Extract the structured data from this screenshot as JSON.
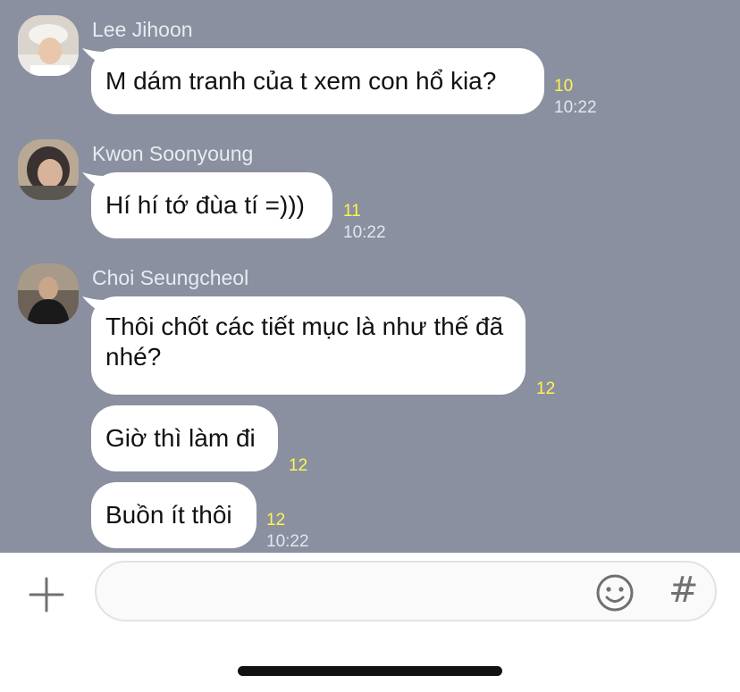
{
  "messages": [
    {
      "sender": "Lee Jihoon",
      "bubbles": [
        {
          "text": "M dám tranh của t xem con hổ kia?",
          "read_count": "10",
          "time": "10:22"
        }
      ]
    },
    {
      "sender": "Kwon Soonyoung",
      "bubbles": [
        {
          "text": "Hí hí tớ đùa tí =)))",
          "read_count": "11",
          "time": "10:22"
        }
      ]
    },
    {
      "sender": "Choi Seungcheol",
      "bubbles": [
        {
          "text": "Thôi chốt các tiết mục là như thế đã nhé?",
          "read_count": "12"
        },
        {
          "text": "Giờ thì làm đi",
          "read_count": "12"
        },
        {
          "text": "Buồn ít thôi",
          "read_count": "12",
          "time": "10:22"
        }
      ]
    }
  ],
  "composer": {
    "plus_icon": "plus-icon",
    "input_value": "",
    "emoji_icon": "smiley-icon",
    "hashtag_label": "#"
  },
  "colors": {
    "chat_background": "#8a90a0",
    "read_count": "#fff44f",
    "bubble": "#ffffff"
  }
}
